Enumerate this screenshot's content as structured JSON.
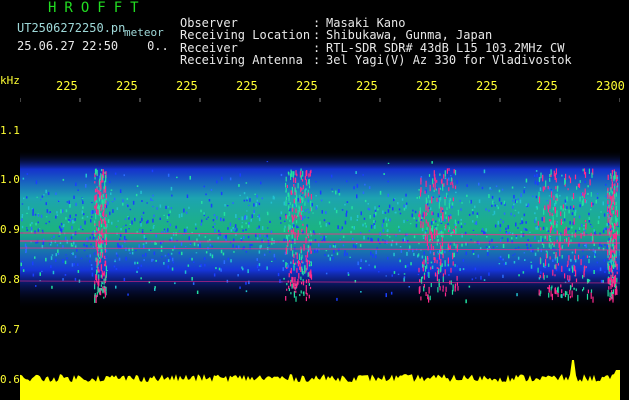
{
  "header": {
    "title": "HROFFT",
    "filename": "UT2506272250.pn",
    "mode": "meteor",
    "datetime": "25.06.27 22:50",
    "counter": "0..",
    "info_labels": [
      "Observer",
      "Receiving Location",
      "Receiver",
      "Receiving Antenna"
    ],
    "info_colon": ":",
    "info_values": [
      "Masaki Kano",
      "Shibukawa, Gunma, Japan",
      "RTL-SDR SDR# 43dB L15 103.2MHz CW",
      "3el Yagi(V) Az 330 for Vladivostok"
    ]
  },
  "axis": {
    "unit": "kHz",
    "x_ticks": [
      "225",
      "225",
      "225",
      "225",
      "225",
      "225",
      "225",
      "225",
      "225",
      "2300"
    ],
    "y_ticks": [
      "1.1",
      "1.0",
      "0.9",
      "0.8",
      "0.7",
      "0.6"
    ]
  },
  "colors": {
    "background": "#000000",
    "title": "#22dd22",
    "label": "#9ed8d8",
    "axis": "#ffff33",
    "signal_strong": "#ff2a8a",
    "signal_mid": "#22e0a0",
    "signal_low": "#1a3fff",
    "power_trace": "#ffff00"
  }
}
